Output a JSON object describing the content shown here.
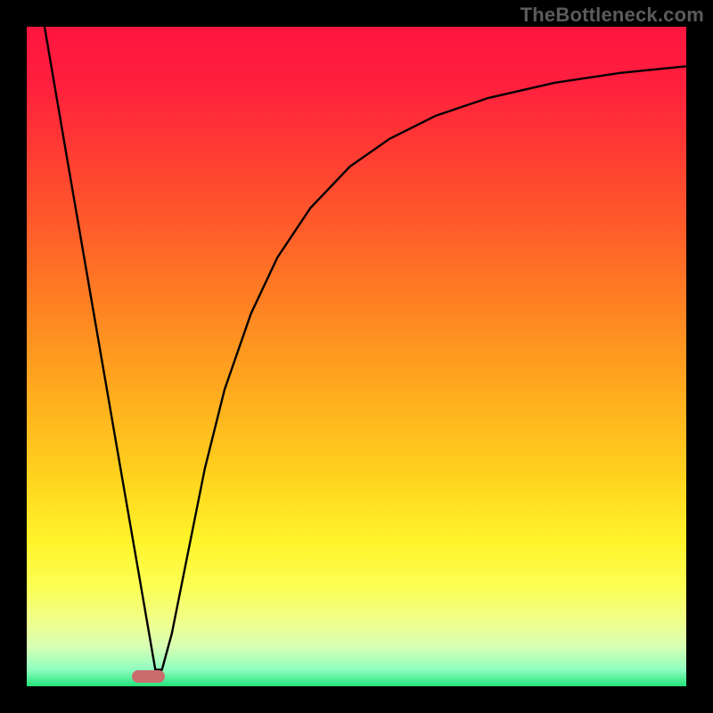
{
  "watermark": "TheBottleneck.com",
  "gradient_stops": [
    {
      "offset": 0.0,
      "color": "#ff153f"
    },
    {
      "offset": 0.08,
      "color": "#ff1e3e"
    },
    {
      "offset": 0.18,
      "color": "#ff3934"
    },
    {
      "offset": 0.3,
      "color": "#ff5b2a"
    },
    {
      "offset": 0.42,
      "color": "#ff8123"
    },
    {
      "offset": 0.55,
      "color": "#ffaa1e"
    },
    {
      "offset": 0.68,
      "color": "#ffd21e"
    },
    {
      "offset": 0.78,
      "color": "#fff42a"
    },
    {
      "offset": 0.85,
      "color": "#fbff55"
    },
    {
      "offset": 0.9,
      "color": "#f0ff8a"
    },
    {
      "offset": 0.94,
      "color": "#d8ffb4"
    },
    {
      "offset": 0.975,
      "color": "#8effc0"
    },
    {
      "offset": 1.0,
      "color": "#23e37a"
    }
  ],
  "curve_stroke": "#000000",
  "curve_width": 2.4,
  "marker": {
    "color": "#cc6b6e",
    "x_frac": 0.185,
    "y_frac": 0.985,
    "w_frac": 0.05,
    "h_frac": 0.018
  },
  "chart_data": {
    "type": "line",
    "title": "",
    "xlabel": "",
    "ylabel": "",
    "xlim": [
      0,
      100
    ],
    "ylim": [
      0,
      100
    ],
    "note": "No numeric ticks/labels shown. Values are geometric fractions (0–100) of plot area; bottleneck minimum at x≈19.",
    "series": [
      {
        "name": "bottleneck-curve",
        "x": [
          2.7,
          6,
          10,
          14,
          17,
          18.5,
          19.5,
          20.5,
          22,
          24,
          27,
          30,
          34,
          38,
          43,
          49,
          55,
          62,
          70,
          80,
          90,
          100
        ],
        "y": [
          100,
          80.7,
          57.5,
          34.3,
          17.0,
          8.3,
          2.5,
          2.5,
          8.0,
          18.0,
          33.0,
          45.0,
          56.5,
          65.0,
          72.5,
          78.8,
          83.0,
          86.5,
          89.2,
          91.5,
          93.0,
          94.0
        ]
      }
    ],
    "minimum_marker_x": 19
  }
}
